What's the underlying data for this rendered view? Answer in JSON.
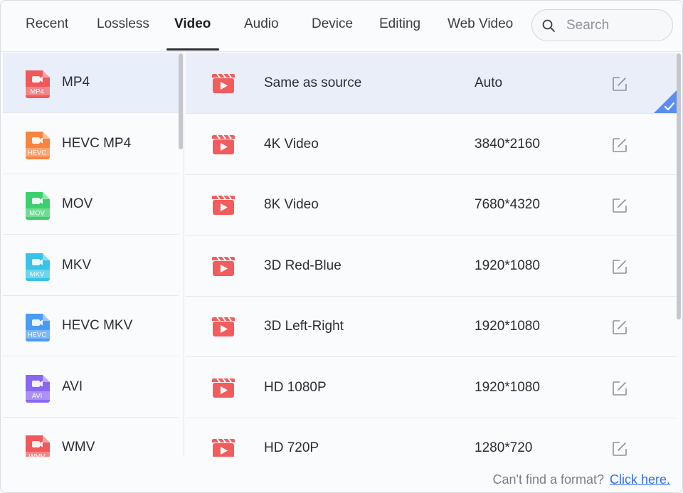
{
  "tabs": [
    {
      "label": "Recent"
    },
    {
      "label": "Lossless"
    },
    {
      "label": "Video"
    },
    {
      "label": "Audio"
    },
    {
      "label": "Device"
    },
    {
      "label": "Editing"
    },
    {
      "label": "Web Video"
    }
  ],
  "active_tab": "Video",
  "search": {
    "placeholder": "Search",
    "value": ""
  },
  "formats": [
    {
      "label": "MP4",
      "badge": "MP4",
      "color": "#f0585a",
      "selected": true
    },
    {
      "label": "HEVC MP4",
      "badge": "HEVC",
      "color": "#f7843f"
    },
    {
      "label": "MOV",
      "badge": "MOV",
      "color": "#3ccf6e"
    },
    {
      "label": "MKV",
      "badge": "MKV",
      "color": "#38c4e6"
    },
    {
      "label": "HEVC MKV",
      "badge": "HEVC",
      "color": "#4a9cf3"
    },
    {
      "label": "AVI",
      "badge": "AVI",
      "color": "#8a67f0"
    },
    {
      "label": "WMV",
      "badge": "WMV",
      "color": "#f0585a"
    }
  ],
  "presets": [
    {
      "name": "Same as source",
      "resolution": "Auto",
      "selected": true
    },
    {
      "name": "4K Video",
      "resolution": "3840*2160"
    },
    {
      "name": "8K Video",
      "resolution": "7680*4320"
    },
    {
      "name": "3D Red-Blue",
      "resolution": "1920*1080"
    },
    {
      "name": "3D Left-Right",
      "resolution": "1920*1080"
    },
    {
      "name": "HD 1080P",
      "resolution": "1920*1080"
    },
    {
      "name": "HD 720P",
      "resolution": "1280*720"
    }
  ],
  "footer": {
    "prompt": "Can't find a format?",
    "link": " Click here."
  },
  "colors": {
    "accent": "#2f6fe4",
    "preset_icon": "#f25c5c",
    "selection": "#e8eefa",
    "check": "#5b8def"
  },
  "icons": {
    "search": "search-icon",
    "edit": "edit-icon",
    "preset": "video-clapper-icon",
    "check": "checkmark-icon"
  }
}
